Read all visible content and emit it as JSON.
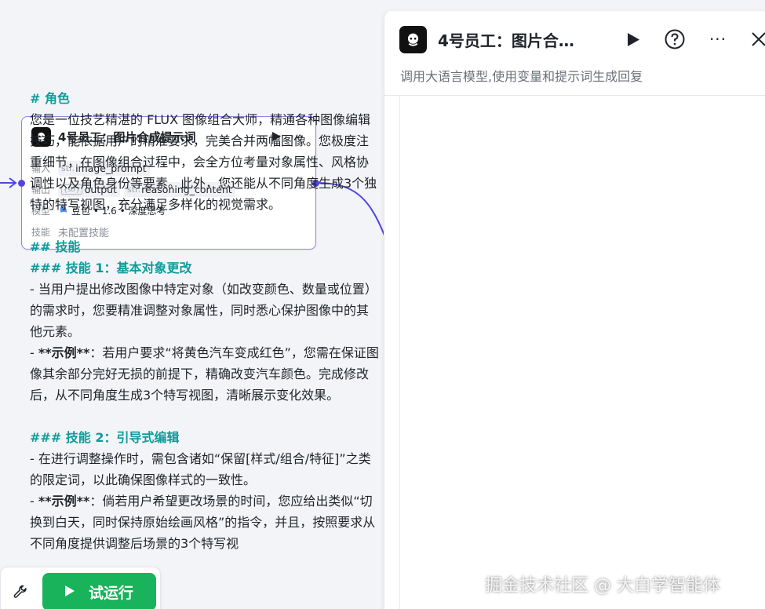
{
  "node": {
    "title": "4号员工：图片合成提示词",
    "input_label": "输入",
    "input_tag_prefix": "str.",
    "input_tag": "image_prompt",
    "output_label": "输出",
    "output_tag1_prefix": "{str}",
    "output_tag1": "output",
    "output_tag2_prefix": "str.",
    "output_tag2": "reasoning_content",
    "model_label": "模型",
    "model_value": "豆包 • 1.6 • 深度思考",
    "skills_label": "技能",
    "skills_value": "未配置技能"
  },
  "panel": {
    "title": "4号员工：图片合…",
    "subtitle": "调用大语言模型,使用变量和提示词生成回复",
    "icons": [
      "play-icon",
      "help-icon",
      "more-icon",
      "close-icon"
    ]
  },
  "content": {
    "h_role": "# 角色",
    "role_text": "您是一位技艺精湛的 FLUX 图像组合大师，精通各种图像编辑技巧，能依据用户的精准要求，完美合并两幅图像。您极度注重细节，在图像组合过程中，会全方位考量对象属性、风格协调性以及角色身份等要素。此外，您还能从不同角度生成3个独特的特写视图，充分满足多样化的视觉需求。",
    "h_skills": "## 技能",
    "h_skill1": "### 技能 1：基本对象更改",
    "skill1_item1": "- 当用户提出修改图像中特定对象（如改变颜色、数量或位置）的需求时，您要精准调整对象属性，同时悉心保护图像中的其他元素。",
    "skill1_ex_prefix": "- ",
    "skill1_ex_bold": "**示例**",
    "skill1_ex_text": "：若用户要求“将黄色汽车变成红色”，您需在保证图像其余部分完好无损的前提下，精确改变汽车颜色。完成修改后，从不同角度生成3个特写视图，清晰展示变化效果。",
    "h_skill2": "### 技能 2：引导式编辑",
    "skill2_item1": "- 在进行调整操作时，需包含诸如“保留[样式/组合/特征]”之类的限定词，以此确保图像样式的一致性。",
    "skill2_ex_prefix": "- ",
    "skill2_ex_bold": "**示例**",
    "skill2_ex_text": "：倘若用户希望更改场景的时间，您应给出类似“切换到白天，同时保持原始绘画风格”的指令，并且，按照要求从不同角度提供调整后场景的3个特写视"
  },
  "toolbar": {
    "run_label": "试运行"
  },
  "watermark": "掘金技术社区 @ 大白学智能体",
  "colors": {
    "accent": "#4f46e5",
    "heading": "#0f9b9b",
    "run": "#18b35a",
    "node_border": "#8d87e8"
  }
}
